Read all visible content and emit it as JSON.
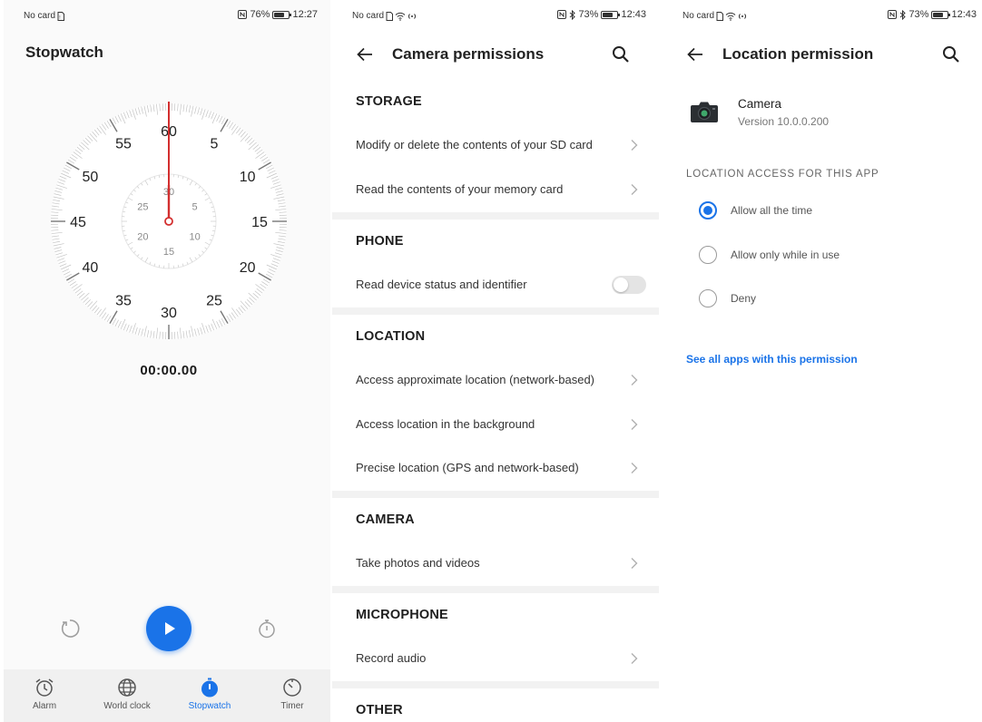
{
  "screens": {
    "stopwatch": {
      "status": {
        "left_text": "No card",
        "battery": "76%",
        "battery_level": 0.76,
        "time": "12:27"
      },
      "title": "Stopwatch",
      "dial_labels": [
        "60",
        "5",
        "10",
        "15",
        "20",
        "25",
        "30",
        "35",
        "40",
        "45",
        "50",
        "55"
      ],
      "subdial_labels": [
        "30",
        "5",
        "10",
        "15",
        "20",
        "25"
      ],
      "elapsed": "00:00.00",
      "tabs": [
        {
          "label": "Alarm",
          "icon": "alarm-clock-icon",
          "active": false
        },
        {
          "label": "World clock",
          "icon": "globe-icon",
          "active": false
        },
        {
          "label": "Stopwatch",
          "icon": "stopwatch-icon",
          "active": true
        },
        {
          "label": "Timer",
          "icon": "timer-icon",
          "active": false
        }
      ],
      "accent_color": "#1a73e8",
      "hand_color": "#d32f2f"
    },
    "camera_permissions": {
      "status": {
        "left_text": "No card",
        "battery": "73%",
        "battery_level": 0.73,
        "time": "12:43"
      },
      "title": "Camera permissions",
      "sections": [
        {
          "heading": "STORAGE",
          "items": [
            "Modify or delete the contents of your SD card",
            "Read the contents of your memory card"
          ]
        },
        {
          "heading": "PHONE",
          "items": [
            "Read device status and identifier"
          ],
          "toggle": true,
          "toggle_on": false
        },
        {
          "heading": "LOCATION",
          "items": [
            "Access approximate location (network-based)",
            "Access location in the background",
            "Precise location (GPS and network-based)"
          ]
        },
        {
          "heading": "CAMERA",
          "items": [
            "Take photos and videos"
          ]
        },
        {
          "heading": "MICROPHONE",
          "items": [
            "Record audio"
          ]
        },
        {
          "heading": "OTHER",
          "items": []
        }
      ]
    },
    "location_permission": {
      "status": {
        "left_text": "No card",
        "battery": "73%",
        "battery_level": 0.73,
        "time": "12:43"
      },
      "title": "Location permission",
      "app_name": "Camera",
      "app_version": "Version 10.0.0.200",
      "section_heading": "LOCATION ACCESS FOR THIS APP",
      "options": [
        {
          "label": "Allow all the time",
          "checked": true
        },
        {
          "label": "Allow only while in use",
          "checked": false
        },
        {
          "label": "Deny",
          "checked": false
        }
      ],
      "see_all_link": "See all apps with this permission",
      "link_color": "#1a73e8"
    }
  }
}
